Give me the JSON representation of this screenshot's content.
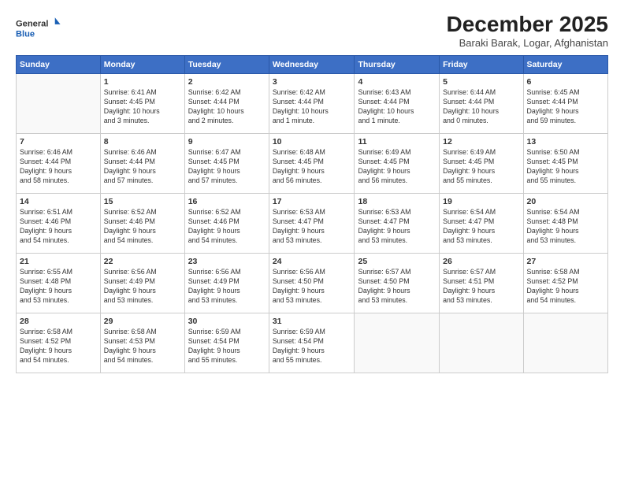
{
  "logo": {
    "line1": "General",
    "line2": "Blue"
  },
  "title": "December 2025",
  "subtitle": "Baraki Barak, Logar, Afghanistan",
  "days_of_week": [
    "Sunday",
    "Monday",
    "Tuesday",
    "Wednesday",
    "Thursday",
    "Friday",
    "Saturday"
  ],
  "weeks": [
    [
      {
        "day": "",
        "info": ""
      },
      {
        "day": "1",
        "info": "Sunrise: 6:41 AM\nSunset: 4:45 PM\nDaylight: 10 hours\nand 3 minutes."
      },
      {
        "day": "2",
        "info": "Sunrise: 6:42 AM\nSunset: 4:44 PM\nDaylight: 10 hours\nand 2 minutes."
      },
      {
        "day": "3",
        "info": "Sunrise: 6:42 AM\nSunset: 4:44 PM\nDaylight: 10 hours\nand 1 minute."
      },
      {
        "day": "4",
        "info": "Sunrise: 6:43 AM\nSunset: 4:44 PM\nDaylight: 10 hours\nand 1 minute."
      },
      {
        "day": "5",
        "info": "Sunrise: 6:44 AM\nSunset: 4:44 PM\nDaylight: 10 hours\nand 0 minutes."
      },
      {
        "day": "6",
        "info": "Sunrise: 6:45 AM\nSunset: 4:44 PM\nDaylight: 9 hours\nand 59 minutes."
      }
    ],
    [
      {
        "day": "7",
        "info": "Sunrise: 6:46 AM\nSunset: 4:44 PM\nDaylight: 9 hours\nand 58 minutes."
      },
      {
        "day": "8",
        "info": "Sunrise: 6:46 AM\nSunset: 4:44 PM\nDaylight: 9 hours\nand 57 minutes."
      },
      {
        "day": "9",
        "info": "Sunrise: 6:47 AM\nSunset: 4:45 PM\nDaylight: 9 hours\nand 57 minutes."
      },
      {
        "day": "10",
        "info": "Sunrise: 6:48 AM\nSunset: 4:45 PM\nDaylight: 9 hours\nand 56 minutes."
      },
      {
        "day": "11",
        "info": "Sunrise: 6:49 AM\nSunset: 4:45 PM\nDaylight: 9 hours\nand 56 minutes."
      },
      {
        "day": "12",
        "info": "Sunrise: 6:49 AM\nSunset: 4:45 PM\nDaylight: 9 hours\nand 55 minutes."
      },
      {
        "day": "13",
        "info": "Sunrise: 6:50 AM\nSunset: 4:45 PM\nDaylight: 9 hours\nand 55 minutes."
      }
    ],
    [
      {
        "day": "14",
        "info": "Sunrise: 6:51 AM\nSunset: 4:46 PM\nDaylight: 9 hours\nand 54 minutes."
      },
      {
        "day": "15",
        "info": "Sunrise: 6:52 AM\nSunset: 4:46 PM\nDaylight: 9 hours\nand 54 minutes."
      },
      {
        "day": "16",
        "info": "Sunrise: 6:52 AM\nSunset: 4:46 PM\nDaylight: 9 hours\nand 54 minutes."
      },
      {
        "day": "17",
        "info": "Sunrise: 6:53 AM\nSunset: 4:47 PM\nDaylight: 9 hours\nand 53 minutes."
      },
      {
        "day": "18",
        "info": "Sunrise: 6:53 AM\nSunset: 4:47 PM\nDaylight: 9 hours\nand 53 minutes."
      },
      {
        "day": "19",
        "info": "Sunrise: 6:54 AM\nSunset: 4:47 PM\nDaylight: 9 hours\nand 53 minutes."
      },
      {
        "day": "20",
        "info": "Sunrise: 6:54 AM\nSunset: 4:48 PM\nDaylight: 9 hours\nand 53 minutes."
      }
    ],
    [
      {
        "day": "21",
        "info": "Sunrise: 6:55 AM\nSunset: 4:48 PM\nDaylight: 9 hours\nand 53 minutes."
      },
      {
        "day": "22",
        "info": "Sunrise: 6:56 AM\nSunset: 4:49 PM\nDaylight: 9 hours\nand 53 minutes."
      },
      {
        "day": "23",
        "info": "Sunrise: 6:56 AM\nSunset: 4:49 PM\nDaylight: 9 hours\nand 53 minutes."
      },
      {
        "day": "24",
        "info": "Sunrise: 6:56 AM\nSunset: 4:50 PM\nDaylight: 9 hours\nand 53 minutes."
      },
      {
        "day": "25",
        "info": "Sunrise: 6:57 AM\nSunset: 4:50 PM\nDaylight: 9 hours\nand 53 minutes."
      },
      {
        "day": "26",
        "info": "Sunrise: 6:57 AM\nSunset: 4:51 PM\nDaylight: 9 hours\nand 53 minutes."
      },
      {
        "day": "27",
        "info": "Sunrise: 6:58 AM\nSunset: 4:52 PM\nDaylight: 9 hours\nand 54 minutes."
      }
    ],
    [
      {
        "day": "28",
        "info": "Sunrise: 6:58 AM\nSunset: 4:52 PM\nDaylight: 9 hours\nand 54 minutes."
      },
      {
        "day": "29",
        "info": "Sunrise: 6:58 AM\nSunset: 4:53 PM\nDaylight: 9 hours\nand 54 minutes."
      },
      {
        "day": "30",
        "info": "Sunrise: 6:59 AM\nSunset: 4:54 PM\nDaylight: 9 hours\nand 55 minutes."
      },
      {
        "day": "31",
        "info": "Sunrise: 6:59 AM\nSunset: 4:54 PM\nDaylight: 9 hours\nand 55 minutes."
      },
      {
        "day": "",
        "info": ""
      },
      {
        "day": "",
        "info": ""
      },
      {
        "day": "",
        "info": ""
      }
    ]
  ]
}
